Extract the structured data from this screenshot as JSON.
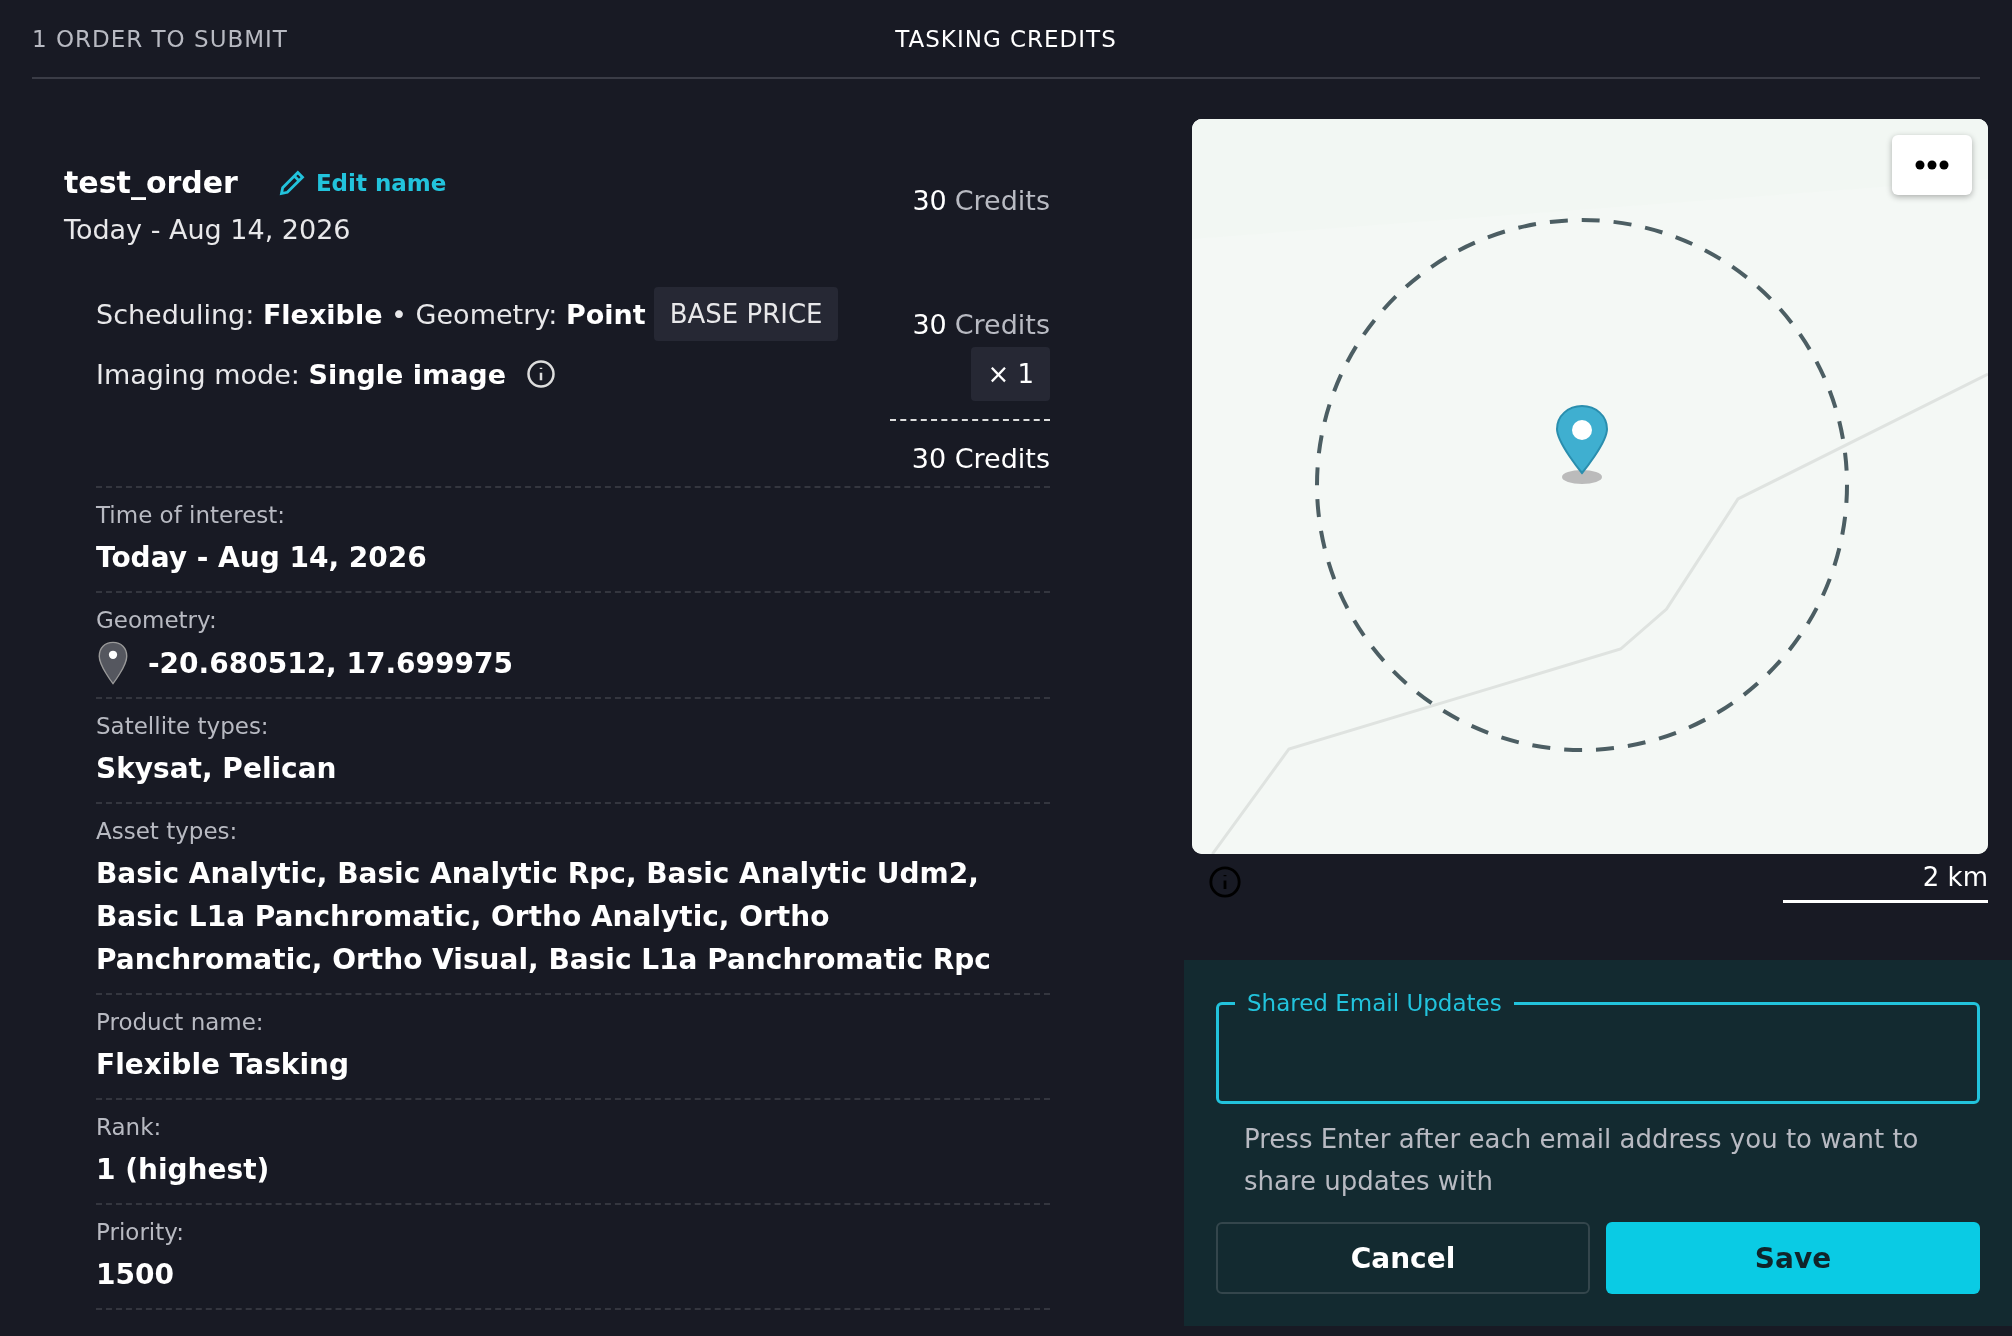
{
  "header": {
    "order_count": "1 ORDER TO SUBMIT",
    "credits_title": "TASKING CREDITS"
  },
  "order": {
    "name": "test_order",
    "edit_label": "Edit name",
    "date": "Today - Aug 14, 2026",
    "credits": {
      "amount": "30",
      "unit": "Credits"
    }
  },
  "pricing": {
    "summary": "Scheduling: **Flexible** • Geometry: **Point**",
    "imaging_mode": "Imaging mode: **Single image**",
    "base_price_label": "BASE PRICE",
    "base_credits": {
      "amount": "30",
      "unit": "Credits"
    },
    "multiplier": "× 1",
    "total": "30 Credits"
  },
  "details": [
    {
      "kind": "text",
      "label": "Time of interest:",
      "value": "Today - Aug 14, 2026"
    },
    {
      "kind": "geometry",
      "label": "Geometry:",
      "value": "-20.680512, 17.699975"
    },
    {
      "kind": "text",
      "label": "Satellite types:",
      "value": "Skysat, Pelican"
    },
    {
      "kind": "text",
      "label": "Asset types:",
      "value": "Basic Analytic, Basic Analytic Rpc, Basic Analytic Udm2, Basic L1a Panchromatic, Ortho Analytic, Ortho Panchromatic, Ortho Visual, Basic L1a Panchromatic Rpc"
    },
    {
      "kind": "text",
      "label": "Product name:",
      "value": "Flexible Tasking"
    },
    {
      "kind": "text",
      "label": "Rank:",
      "value": "1 (highest)"
    },
    {
      "kind": "text",
      "label": "Priority:",
      "value": "1500"
    }
  ],
  "map": {
    "scale": "2 km"
  },
  "email": {
    "label": "Shared Email Updates",
    "hint": "Press Enter after each email address you to want to share updates with",
    "buttons": [
      {
        "kind": "secondary",
        "label": "Cancel"
      },
      {
        "kind": "primary",
        "label": "Save"
      }
    ]
  }
}
